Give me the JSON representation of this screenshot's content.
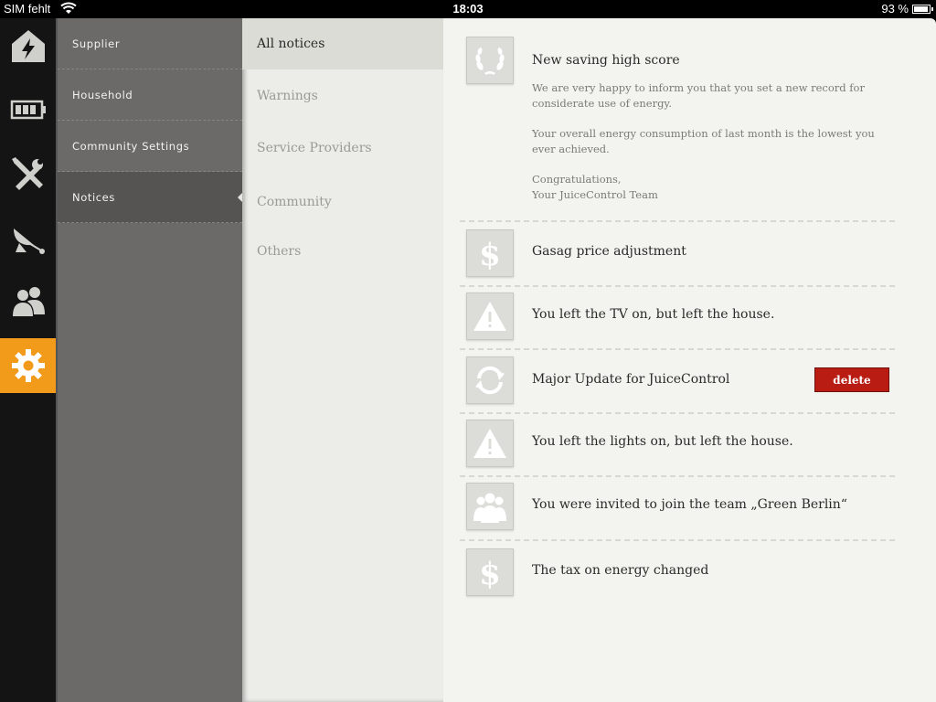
{
  "status_bar": {
    "carrier": "SIM fehlt",
    "time": "18:03",
    "battery_percent": "93 %",
    "battery_level": 0.93
  },
  "rail": {
    "items": [
      {
        "icon": "lightning-house-icon",
        "active": false
      },
      {
        "icon": "battery-icon",
        "active": false
      },
      {
        "icon": "tools-icon",
        "active": false
      },
      {
        "icon": "satellite-dish-icon",
        "active": false
      },
      {
        "icon": "people-icon",
        "active": false
      },
      {
        "icon": "gear-icon",
        "active": true
      }
    ],
    "accent_color": "#f29a1a"
  },
  "menu": {
    "items": [
      {
        "label": "Supplier"
      },
      {
        "label": "Household"
      },
      {
        "label": "Community Settings"
      },
      {
        "label": "Notices"
      }
    ],
    "active_index": 3
  },
  "categories": {
    "items": [
      {
        "label": "All notices"
      },
      {
        "label": "Warnings"
      },
      {
        "label": "Service Providers"
      },
      {
        "label": "Community"
      },
      {
        "label": "Others"
      }
    ],
    "active_index": 0
  },
  "notices": [
    {
      "icon": "laurel-wreath-icon",
      "title": "New saving high score",
      "body": [
        "We are very happy to inform you that you set a new record for considerate use of energy.",
        "Your overall energy consumption of last month is the lowest you ever achieved.",
        "Congratulations,\nYour JuiceControl Team"
      ]
    },
    {
      "icon": "dollar-icon",
      "title": "Gasag price adjustment"
    },
    {
      "icon": "warning-icon",
      "title": "You left the TV on, but left the house."
    },
    {
      "icon": "refresh-icon",
      "title": "Major Update for JuiceControl",
      "action": "delete"
    },
    {
      "icon": "warning-icon",
      "title": "You left the lights on, but left the house."
    },
    {
      "icon": "people-icon",
      "title": "You were invited to join the team „Green Berlin“"
    },
    {
      "icon": "dollar-icon",
      "title": "The tax on energy changed"
    }
  ],
  "delete_color": "#b81c12"
}
